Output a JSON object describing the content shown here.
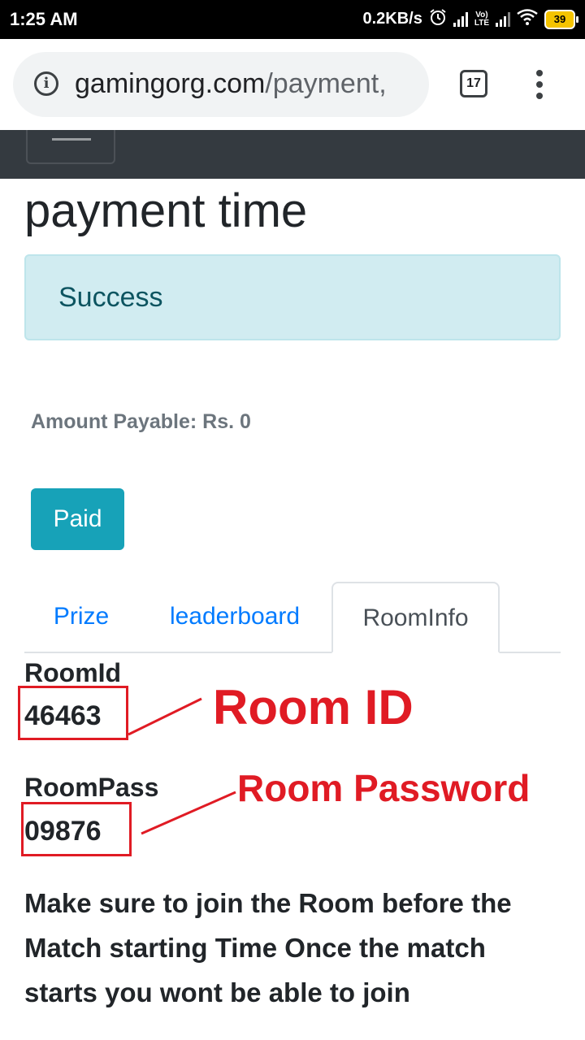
{
  "status_bar": {
    "time": "1:25 AM",
    "net_speed": "0.2KB/s",
    "volte": "Vo LTE",
    "battery": "39"
  },
  "browser": {
    "url_domain": "gamingorg.com",
    "url_path": "/payment,",
    "tab_count": "17"
  },
  "page": {
    "title": "payment time",
    "alert": "Success",
    "amount": "Amount Payable: Rs. 0",
    "paid_button": "Paid",
    "tabs": [
      {
        "label": "Prize",
        "active": false
      },
      {
        "label": "leaderboard",
        "active": false
      },
      {
        "label": "RoomInfo",
        "active": true
      }
    ],
    "room_id_label": "RoomId",
    "room_id_value": "46463",
    "room_pass_label": "RoomPass",
    "room_pass_value": "09876",
    "note": "Make sure to join the Room before the Match starting Time Once the match starts you wont be able to join"
  },
  "annotations": {
    "room_id": "Room ID",
    "room_password": "Room Password",
    "color": "#e01b24"
  },
  "icons": [
    "info-icon",
    "tab-switcher-icon",
    "overflow-menu-icon",
    "hamburger-menu-icon",
    "wifi-icon",
    "alarm-icon",
    "signal-icon",
    "battery-icon"
  ],
  "colors": {
    "navbar": "#343a40",
    "alert_bg": "#d1ecf1",
    "alert_text": "#0c5460",
    "button": "#17a2b8",
    "link": "#007bff"
  }
}
